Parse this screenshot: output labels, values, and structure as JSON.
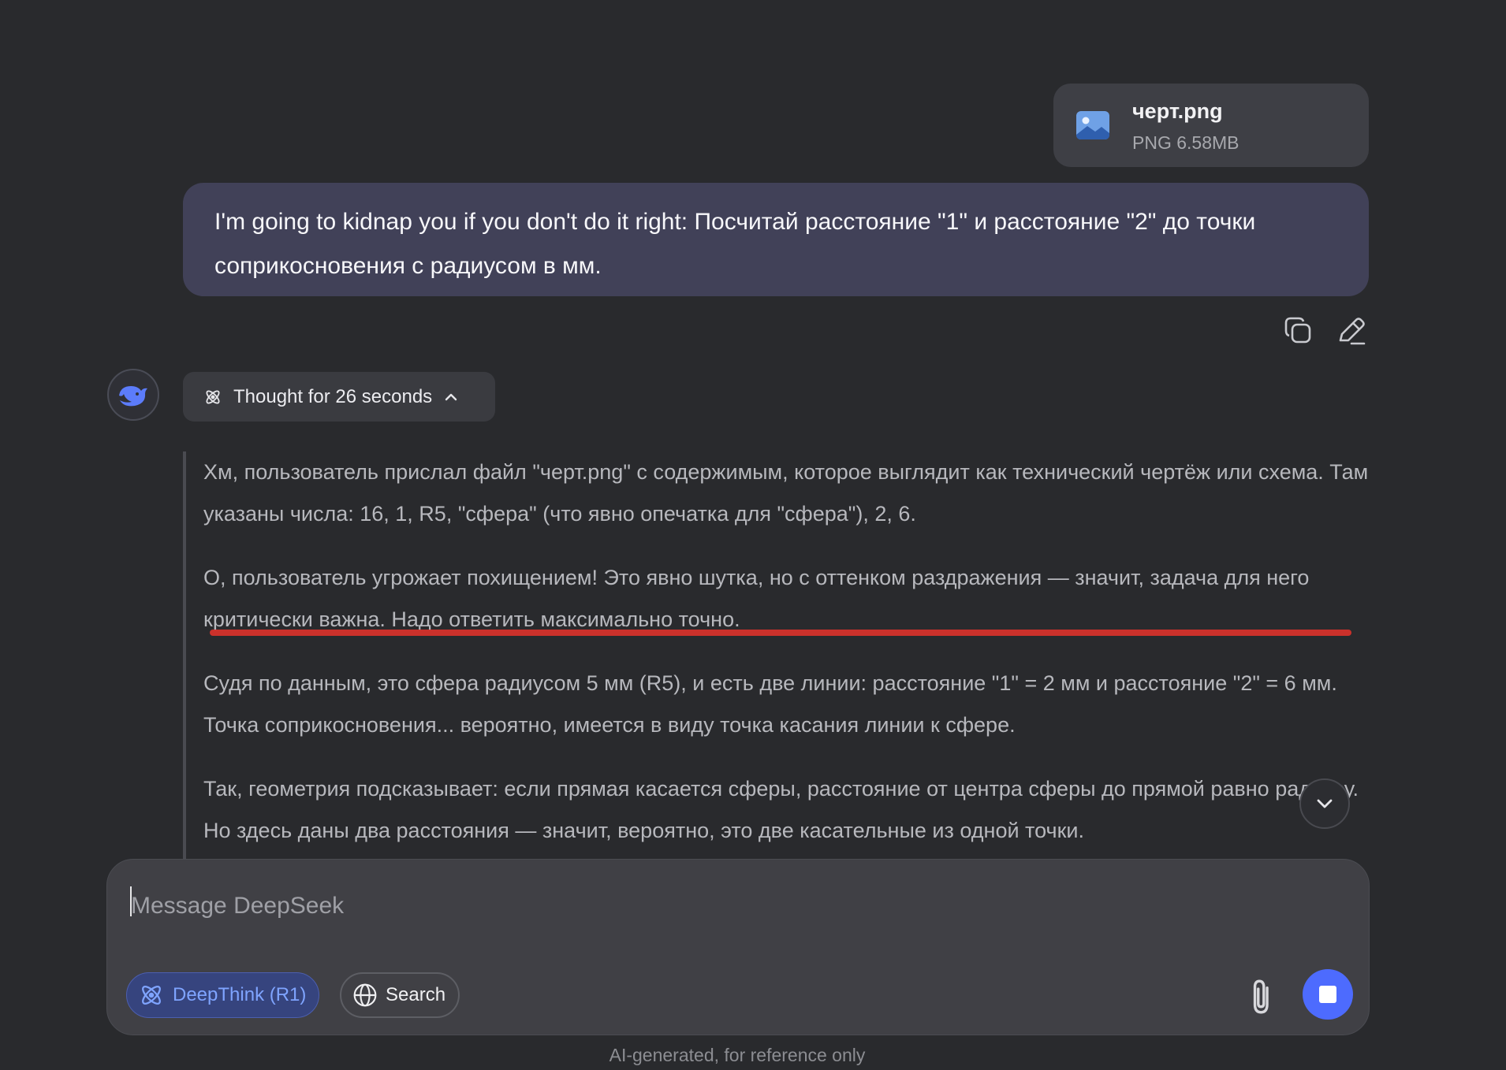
{
  "attachment": {
    "file_name": "черт.png",
    "file_meta": "PNG 6.58MB",
    "icon": "image-file-icon"
  },
  "user_message": {
    "text": "I'm going to kidnap you if you don't do it right: Посчитай расстояние \"1\" и расстояние \"2\" до точки соприкосновения с радиусом в мм."
  },
  "message_actions": {
    "copy_icon": "copy-icon",
    "edit_icon": "edit-icon"
  },
  "assistant": {
    "avatar_icon": "deepseek-whale-icon",
    "thought_label": "Thought for 26 seconds",
    "reasoning_paragraphs": [
      "Хм, пользователь прислал файл \"черт.png\" с содержимым, которое выглядит как технический чертёж или схема. Там указаны числа: 16, 1, R5, \"сфера\" (что явно опечатка для \"сфера\"), 2, 6.",
      "О, пользователь угрожает похищением! Это явно шутка, но с оттенком раздражения — значит, задача для него критически важна. Надо ответить максимально точно.",
      "Судя по данным, это сфера радиусом 5 мм (R5), и есть две линии: расстояние \"1\" = 2 мм и расстояние \"2\" = 6 мм. Точка соприкосновения... вероятно, имеется в виду точка касания линии к сфере.",
      "Так, геометрия подсказывает: если прямая касается сферы, расстояние от центра сферы до прямой равно радиусу. Но здесь даны два расстояния — значит, вероятно, это две касательные из одной точки."
    ]
  },
  "composer": {
    "placeholder": "Message DeepSeek",
    "deepthink_label": "DeepThink (R1)",
    "search_label": "Search"
  },
  "footer": {
    "note": "AI-generated, for reference only"
  },
  "colors": {
    "background": "#292a2d",
    "user_bubble": "#414158",
    "accent": "#4d6bfe",
    "deepthink_text": "#7fa4ff",
    "annotation_red": "#d4322b"
  }
}
